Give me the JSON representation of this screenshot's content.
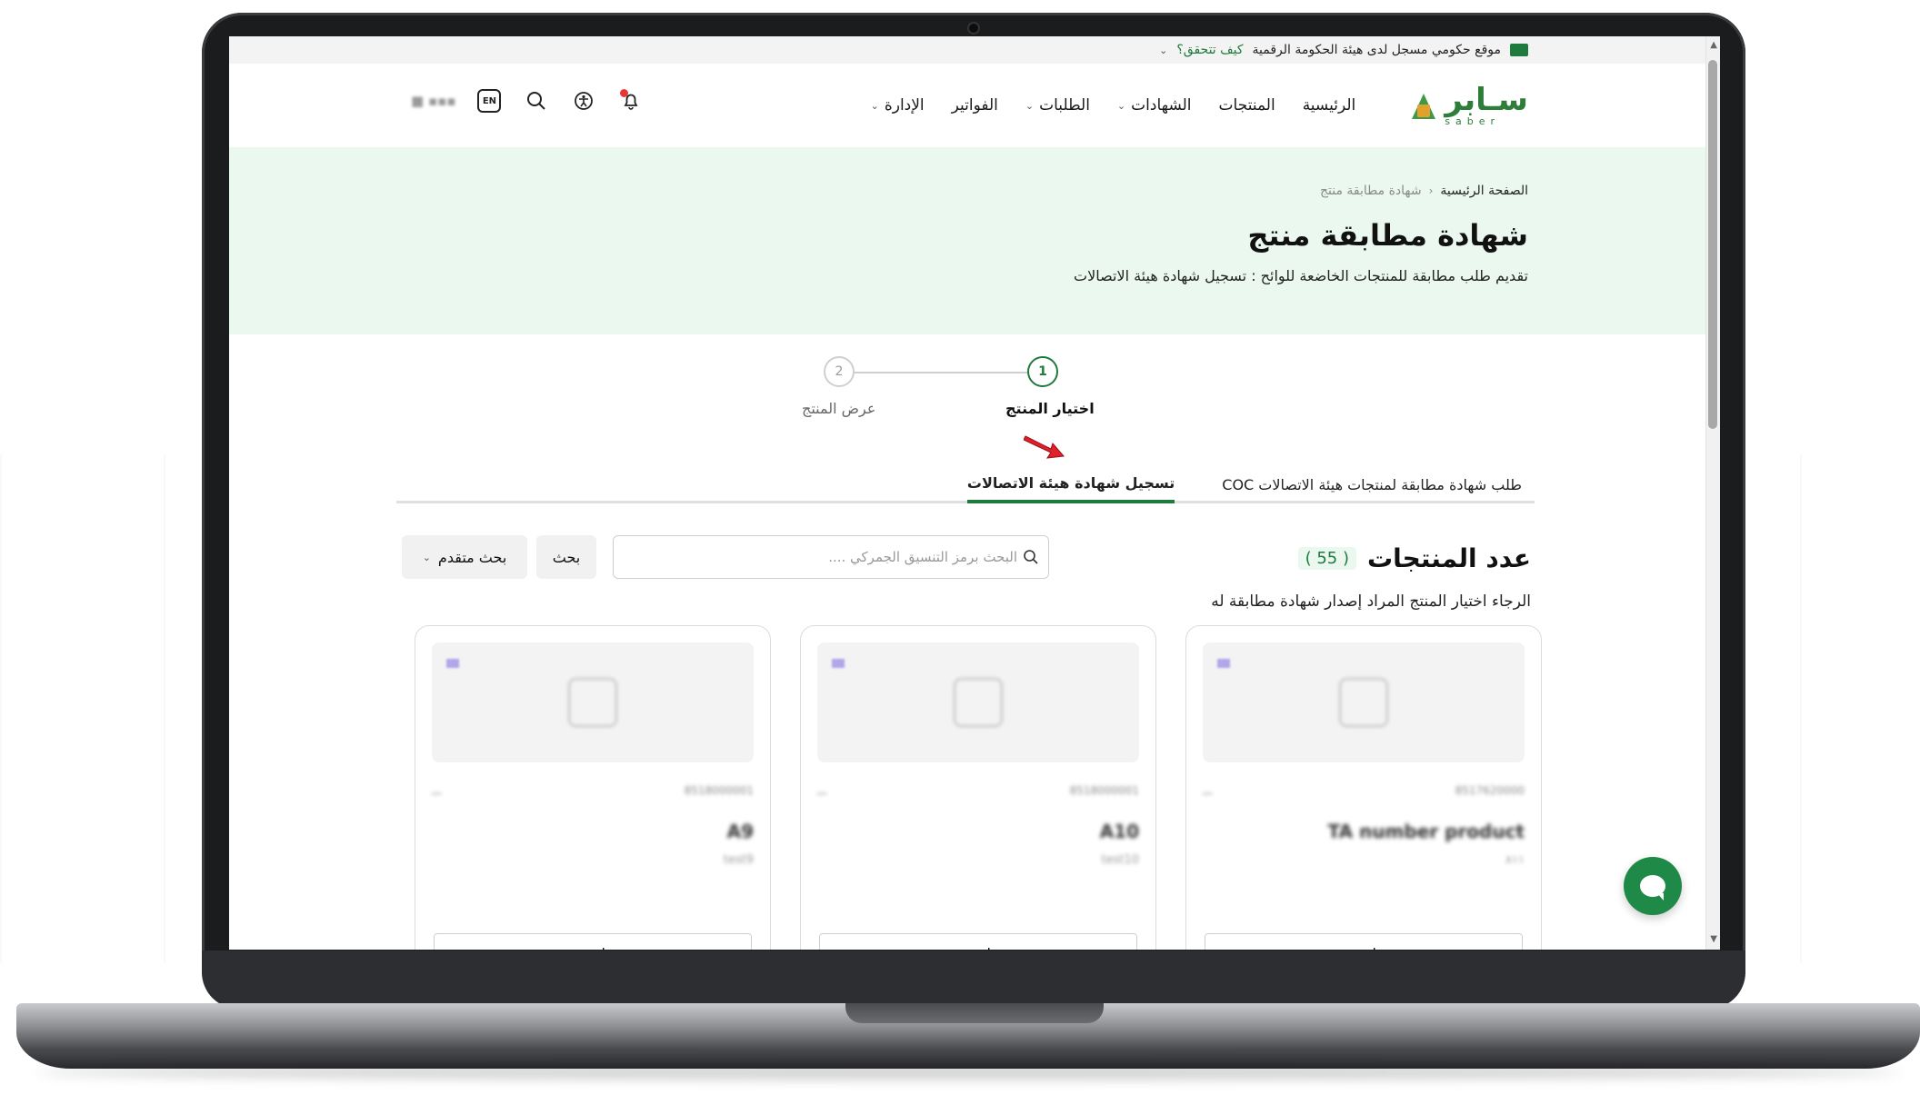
{
  "gov_bar": {
    "text": "موقع حكومي مسجل لدى هيئة الحكومة الرقمية",
    "how_verify": "كيف تتحقق؟"
  },
  "logo": {
    "ar": "سـابر",
    "en": "saber"
  },
  "nav": [
    {
      "label": "الرئيسية",
      "has_dropdown": false
    },
    {
      "label": "المنتجات",
      "has_dropdown": false
    },
    {
      "label": "الشهادات",
      "has_dropdown": true
    },
    {
      "label": "الطلبات",
      "has_dropdown": true
    },
    {
      "label": "الفواتير",
      "has_dropdown": false
    },
    {
      "label": "الإدارة",
      "has_dropdown": true
    }
  ],
  "header_tools": {
    "lang": "EN"
  },
  "breadcrumb": {
    "home": "الصفحة الرئيسية",
    "current": "شهادة مطابقة منتج"
  },
  "page": {
    "title": "شهادة مطابقة منتج",
    "subtitle": "تقديم طلب مطابقة للمنتجات الخاضعة للوائح : تسجيل شهادة هيئة الاتصالات"
  },
  "stepper": [
    {
      "number": "1",
      "label": "اختيار المنتج",
      "active": true
    },
    {
      "number": "2",
      "label": "عرض المنتج",
      "active": false
    }
  ],
  "tabs": [
    {
      "label": "طلب شهادة مطابقة لمنتجات هيئة الاتصالات COC",
      "active": false
    },
    {
      "label": "تسجيل شهادة هيئة الاتصالات",
      "active": true
    }
  ],
  "products": {
    "count_label": "عدد المنتجات",
    "count": "( 55 )",
    "hint": "الرجاء اختيار المنتج المراد إصدار شهادة مطابقة له",
    "search_placeholder": "البحث برمز التنسيق الجمركي ....",
    "search_button": "بحث",
    "advanced_button": "بحث متقدم",
    "items": [
      {
        "code": "8517620000",
        "tag": "ـــ",
        "name": "TA number product",
        "sub": "۸۱۱",
        "select": "اختر"
      },
      {
        "code": "8518000001",
        "tag": "ـــ",
        "name": "A10",
        "sub": "test10",
        "select": "اختر"
      },
      {
        "code": "8518000001",
        "tag": "ـــ",
        "name": "A9",
        "sub": "test9",
        "select": "اختر"
      }
    ]
  },
  "colors": {
    "brand": "#1f7a3e",
    "hero_bg": "#ebf8f0",
    "chat": "#1f8a47"
  }
}
